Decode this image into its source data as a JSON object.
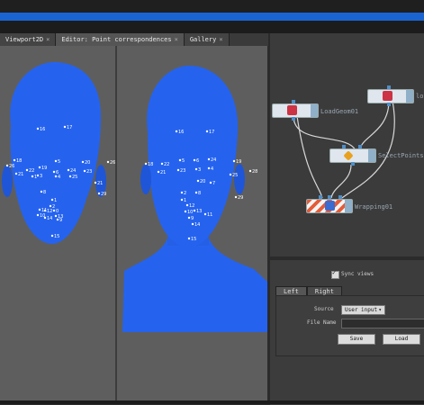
{
  "tabs": [
    {
      "label": "Viewport2D",
      "close": "×"
    },
    {
      "label": "Editor: Point correspondences",
      "close": "×"
    },
    {
      "label": "Gallery",
      "close": "×"
    }
  ],
  "left_face_points": [
    "16",
    "17",
    "18",
    "26",
    "21",
    "22",
    "19",
    "5",
    "6",
    "24",
    "20",
    "26",
    "23",
    "1",
    "3",
    "4",
    "25",
    "21",
    "8",
    "29",
    "1",
    "2",
    "11",
    "12",
    "0",
    "13",
    "10",
    "14",
    "9",
    "15"
  ],
  "right_face_points": [
    "16",
    "17",
    "18",
    "22",
    "5",
    "6",
    "24",
    "19",
    "21",
    "23",
    "3",
    "4",
    "25",
    "28",
    "20",
    "7",
    "29",
    "2",
    "8",
    "1",
    "12",
    "10",
    "13",
    "9",
    "11",
    "14",
    "15"
  ],
  "graph": {
    "nodes": [
      {
        "label": "LoadGeom01"
      },
      {
        "label": "lo"
      },
      {
        "label": "SelectPoints01"
      },
      {
        "label": "Wrapping01"
      }
    ]
  },
  "panel": {
    "sync_label": "Sync views",
    "sync_checked": true,
    "subtabs": [
      "Left",
      "Right"
    ],
    "source_label": "Source",
    "source_value": "User input",
    "source_arrow": "▾",
    "filename_label": "File Name",
    "save_label": "Save",
    "load_label": "Load"
  }
}
